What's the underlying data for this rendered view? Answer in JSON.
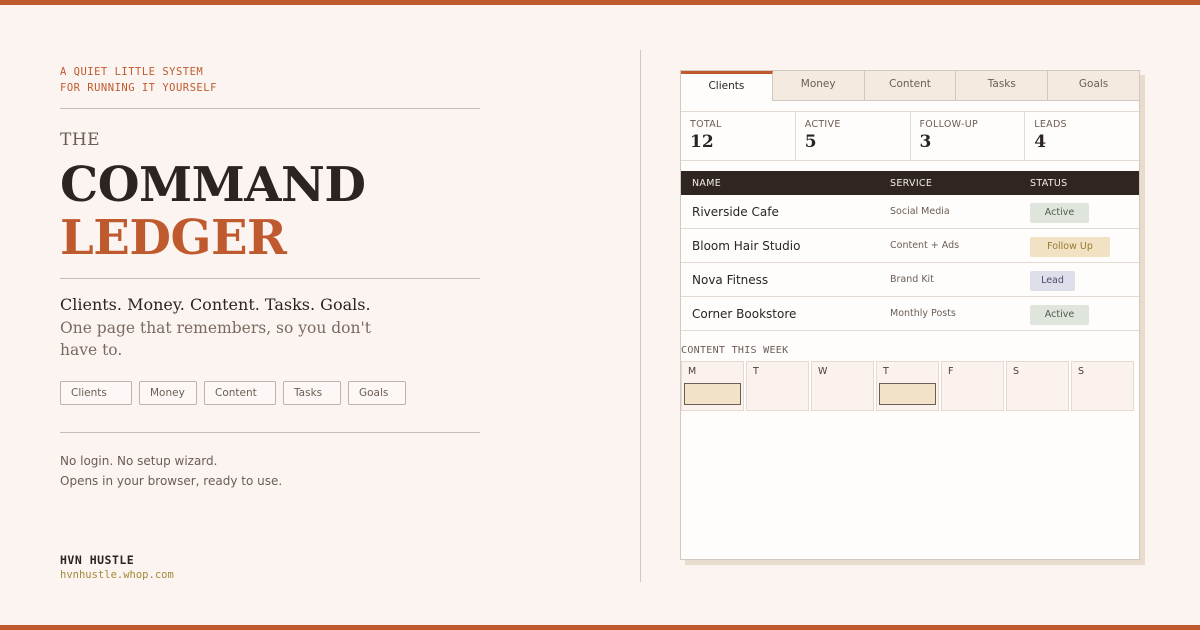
{
  "colors": {
    "accent": "#bf5a2e",
    "dark": "#2f2622",
    "background": "#fcf4f0"
  },
  "left": {
    "eyebrow": [
      "A QUIET LITTLE SYSTEM",
      "FOR RUNNING IT YOURSELF"
    ],
    "the": "THE",
    "title_line1": "COMMAND",
    "title_line2": "LEDGER",
    "tagline": "Clients. Money. Content. Tasks. Goals.",
    "subtitle": "One page that remembers, so you don't have to.",
    "pills": [
      "Clients",
      "Money",
      "Content",
      "Tasks",
      "Goals"
    ],
    "note": [
      "No login. No setup wizard.",
      "Opens in your browser, ready to use."
    ],
    "brand": "HVN HUSTLE",
    "brand_url": "hvnhustle.whop.com"
  },
  "panel": {
    "tabs": [
      "Clients",
      "Money",
      "Content",
      "Tasks",
      "Goals"
    ],
    "active_tab": "Clients",
    "stats": [
      {
        "label": "TOTAL",
        "value": "12"
      },
      {
        "label": "ACTIVE",
        "value": "5"
      },
      {
        "label": "FOLLOW-UP",
        "value": "3"
      },
      {
        "label": "LEADS",
        "value": "4"
      }
    ],
    "table": {
      "headers": [
        "NAME",
        "SERVICE",
        "STATUS"
      ],
      "rows": [
        {
          "name": "Riverside Cafe",
          "service": "Social Media",
          "status": "Active"
        },
        {
          "name": "Bloom Hair Studio",
          "service": "Content + Ads",
          "status": "Follow Up"
        },
        {
          "name": "Nova Fitness",
          "service": "Brand Kit",
          "status": "Lead"
        },
        {
          "name": "Corner Bookstore",
          "service": "Monthly Posts",
          "status": "Active"
        }
      ]
    },
    "week_title": "CONTENT THIS WEEK",
    "days": [
      "M",
      "T",
      "W",
      "T",
      "F",
      "S",
      "S"
    ]
  }
}
